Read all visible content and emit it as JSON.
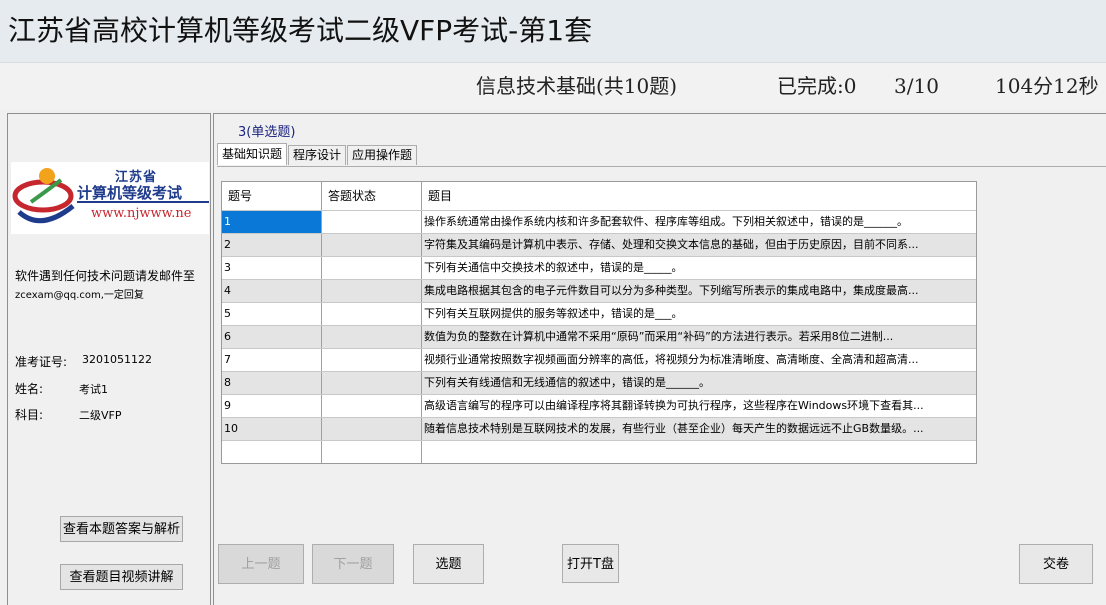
{
  "app": {
    "title": "江苏省高校计算机等级考试二级VFP考试-第1套"
  },
  "status": {
    "section": "信息技术基础(共10题)",
    "completed": "已完成:0",
    "progress": "3/10",
    "timer": "104分12秒"
  },
  "left": {
    "logo": {
      "line1": "江苏省",
      "line2": "计算机等级考试",
      "line3": "www.njwww.ne"
    },
    "support_line1": "软件遇到任何技术问题请发邮件至",
    "support_line2": "zcexam@qq.com,一定回复",
    "exam_id_label": "准考证号:",
    "exam_id_value": "3201051122",
    "name_label": "姓名:",
    "name_value": "考试1",
    "subject_label": "科目:",
    "subject_value": "二级VFP",
    "btn_answer": "查看本题答案与解析",
    "btn_video": "查看题目视频讲解"
  },
  "main": {
    "question_type": "3(单选题)",
    "tabs": [
      "基础知识题",
      "程序设计",
      "应用操作题"
    ],
    "table": {
      "headers": [
        "题号",
        "答题状态",
        "题目"
      ],
      "rows": [
        {
          "num": "1",
          "status": "",
          "text": "操作系统通常由操作系统内核和许多配套软件、程序库等组成。下列相关叙述中，错误的是______。"
        },
        {
          "num": "2",
          "status": "",
          "text": "字符集及其编码是计算机中表示、存储、处理和交换文本信息的基础，但由于历史原因，目前不同系..."
        },
        {
          "num": "3",
          "status": "",
          "text": "下列有关通信中交换技术的叙述中，错误的是_____。"
        },
        {
          "num": "4",
          "status": "",
          "text": "集成电路根据其包含的电子元件数目可以分为多种类型。下列缩写所表示的集成电路中，集成度最高..."
        },
        {
          "num": "5",
          "status": "",
          "text": "下列有关互联网提供的服务等叙述中，错误的是___。"
        },
        {
          "num": "6",
          "status": "",
          "text": "数值为负的整数在计算机中通常不采用“原码”而采用“补码”的方法进行表示。若采用8位二进制..."
        },
        {
          "num": "7",
          "status": "",
          "text": "视频行业通常按照数字视频画面分辨率的高低，将视频分为标准清晰度、高清晰度、全高清和超高清..."
        },
        {
          "num": "8",
          "status": "",
          "text": "下列有关有线通信和无线通信的叙述中，错误的是______。"
        },
        {
          "num": "9",
          "status": "",
          "text": "高级语言编写的程序可以由编译程序将其翻译转换为可执行程序，这些程序在Windows环境下查看其..."
        },
        {
          "num": "10",
          "status": "",
          "text": "随着信息技术特别是互联网技术的发展，有些行业（甚至企业）每天产生的数据远远不止GB数量级。..."
        }
      ]
    },
    "buttons": {
      "prev": "上一题",
      "next": "下一题",
      "select": "选题",
      "open_t": "打开T盘",
      "submit": "交卷"
    }
  },
  "colors": {
    "selected": "#0a78d7",
    "logo_blue": "#1f3b8c",
    "logo_red": "#c6262e"
  }
}
